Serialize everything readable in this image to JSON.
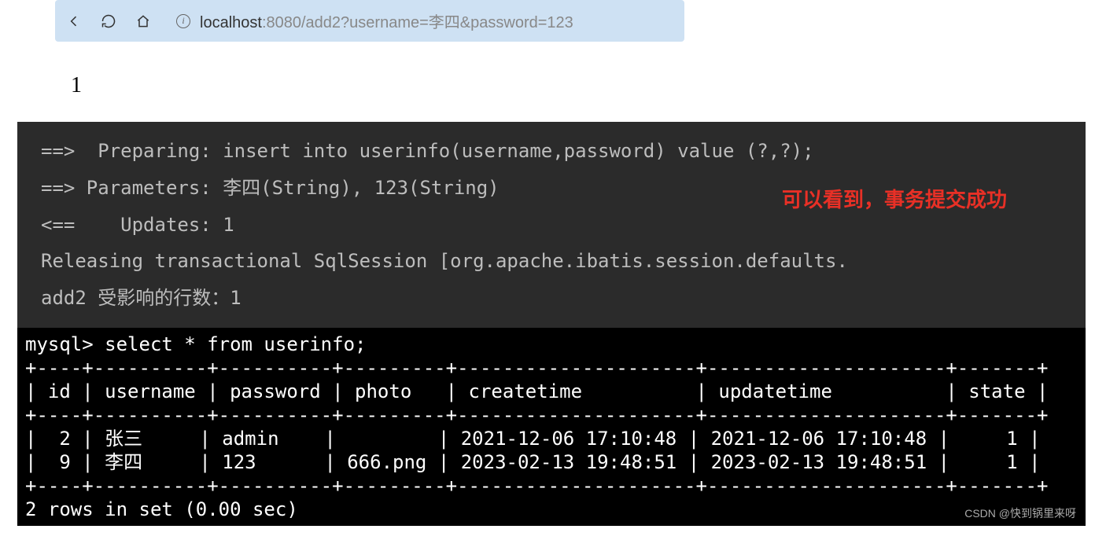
{
  "browser": {
    "url_host": "localhost",
    "url_port": ":8080",
    "url_path": "/add2?username=李四&password=123",
    "info_icon": "i"
  },
  "page_body": "1",
  "console": {
    "l1": "==>  Preparing: insert into userinfo(username,password) value (?,?);",
    "l2": "==> Parameters: 李四(String), 123(String)",
    "l3": "<==    Updates: 1",
    "l4": "Releasing transactional SqlSession [org.apache.ibatis.session.defaults.",
    "l5": "add2 受影响的行数：1",
    "annotation": "可以看到，事务提交成功"
  },
  "mysql": {
    "prompt": "mysql> select * from userinfo;",
    "border_top": "+----+----------+----------+---------+---------------------+---------------------+-------+",
    "header": "| id | username | password | photo   | createtime          | updatetime          | state |",
    "border_mid": "+----+----------+----------+---------+---------------------+---------------------+-------+",
    "row1": "|  2 | 张三     | admin    |         | 2021-12-06 17:10:48 | 2021-12-06 17:10:48 |     1 |",
    "row2": "|  9 | 李四     | 123      | 666.png | 2023-02-13 19:48:51 | 2023-02-13 19:48:51 |     1 |",
    "border_bot": "+----+----------+----------+---------+---------------------+---------------------+-------+",
    "footer": "2 rows in set (0.00 sec)",
    "columns": [
      "id",
      "username",
      "password",
      "photo",
      "createtime",
      "updatetime",
      "state"
    ],
    "rows": [
      {
        "id": 2,
        "username": "张三",
        "password": "admin",
        "photo": "",
        "createtime": "2021-12-06 17:10:48",
        "updatetime": "2021-12-06 17:10:48",
        "state": 1
      },
      {
        "id": 9,
        "username": "李四",
        "password": "123",
        "photo": "666.png",
        "createtime": "2023-02-13 19:48:51",
        "updatetime": "2023-02-13 19:48:51",
        "state": 1
      }
    ]
  },
  "watermark": "CSDN @快到锅里来呀"
}
